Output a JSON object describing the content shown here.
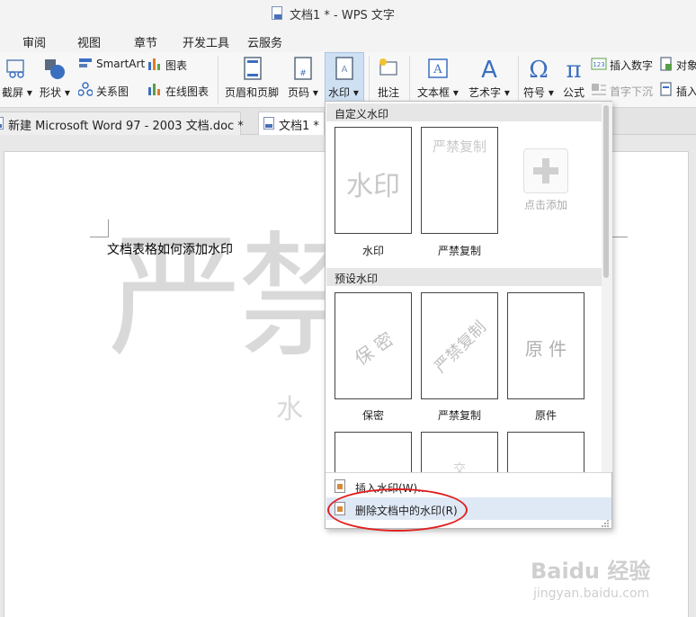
{
  "window": {
    "title": "文档1 * - WPS 文字"
  },
  "menu_tabs": [
    "审阅",
    "视图",
    "章节",
    "开发工具",
    "云服务"
  ],
  "ribbon": {
    "screenshot": "截屏",
    "shapes": "形状",
    "smartart": "SmartArt",
    "relation_chart": "关系图",
    "chart": "图表",
    "online_chart": "在线图表",
    "header_footer": "页眉和页脚",
    "page_number": "页码",
    "watermark": "水印",
    "comment": "批注",
    "textbox": "文本框",
    "wordart": "艺术字",
    "symbol": "符号",
    "formula": "公式",
    "insert_number": "插入数字",
    "dropcap": "首字下沉",
    "object": "对象",
    "insert": "插入"
  },
  "doc_tabs": [
    {
      "label": "新建 Microsoft Word 97 - 2003 文档.doc *"
    },
    {
      "label": "文档1 *"
    }
  ],
  "document": {
    "text": "文档表格如何添加水印",
    "watermark_big": "严禁",
    "watermark_small": "水"
  },
  "dropdown": {
    "custom_header": "自定义水印",
    "custom_items": [
      {
        "thumb_text": "水印",
        "caption": "水印"
      },
      {
        "thumb_text": "严禁复制",
        "caption": "严禁复制"
      }
    ],
    "add_label": "点击添加",
    "preset_header": "预设水印",
    "preset_items": [
      {
        "thumb_text": "保 密",
        "caption": "保密"
      },
      {
        "thumb_text": "严禁复制",
        "caption": "严禁复制"
      },
      {
        "thumb_text": "原 件",
        "caption": "原件"
      }
    ],
    "partial_thumb_text": "交",
    "insert_watermark": "插入水印(W)...",
    "delete_watermark": "删除文档中的水印(R)"
  },
  "baidu": {
    "logo": "Baidu 经验",
    "url": "jingyan.baidu.com"
  },
  "colors": {
    "accent_highlight": "#cfe0f3",
    "annotation_red": "#e02020",
    "watermark_gray": "#d9d9d9"
  }
}
